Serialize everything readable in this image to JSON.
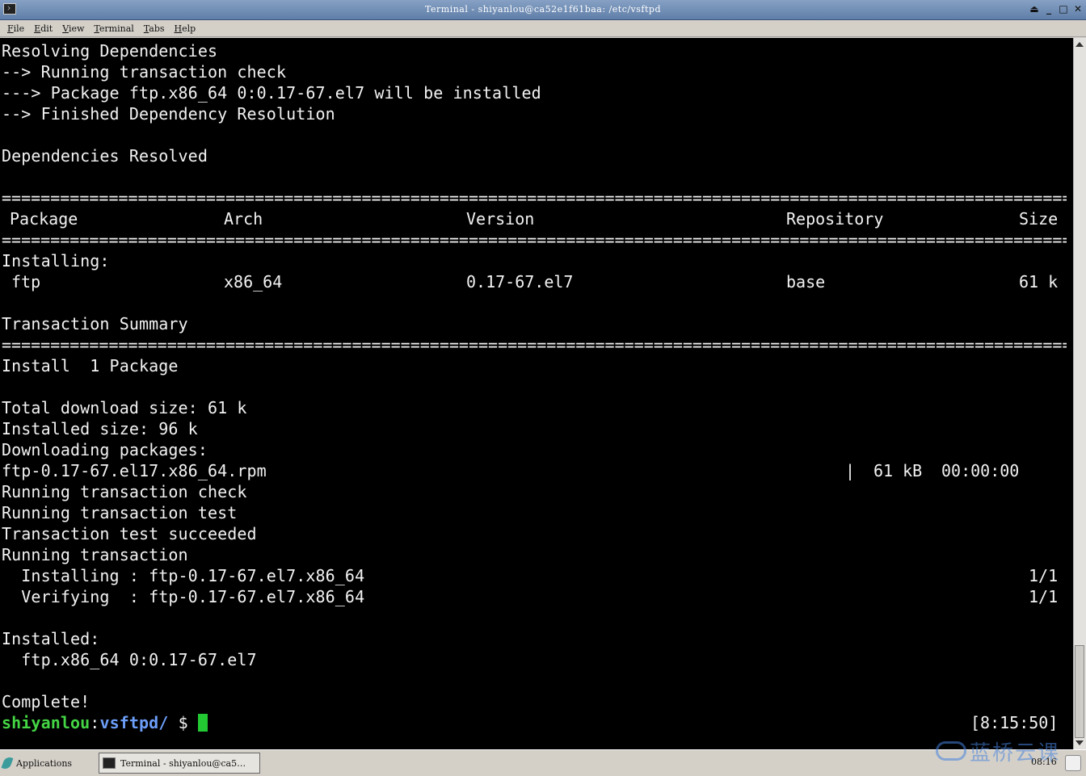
{
  "window": {
    "title": "Terminal - shiyanlou@ca52e1f61baa: /etc/vsftpd",
    "buttons": {
      "shade": "⏏",
      "minimize": "_",
      "maximize": "□",
      "close": "✕"
    }
  },
  "menu": [
    "File",
    "Edit",
    "View",
    "Terminal",
    "Tabs",
    "Help"
  ],
  "terminal": {
    "lines_top": [
      "Resolving Dependencies",
      "--> Running transaction check",
      "---> Package ftp.x86_64 0:0.17-67.el7 will be installed",
      "--> Finished Dependency Resolution",
      "",
      "Dependencies Resolved"
    ],
    "separator": "==============================================================================================================",
    "table_header": {
      "package": "Package",
      "arch": "Arch",
      "version": "Version",
      "repository": "Repository",
      "size": "Size"
    },
    "installing_label": "Installing:",
    "table_row": {
      "package": "ftp",
      "arch": "x86_64",
      "version": "0.17-67.el7",
      "repository": "base",
      "size": "61 k"
    },
    "summary_label": "Transaction Summary",
    "install_count": "Install  1 Package",
    "download_size": "Total download size: 61 k",
    "installed_size": "Installed size: 96 k",
    "downloading": "Downloading packages:",
    "rpm": {
      "file": "ftp-0.17-67.el17.x86_64.rpm",
      "bar": "|",
      "size": "61 kB",
      "time": "00:00:00"
    },
    "running_check": "Running transaction check",
    "running_test": "Running transaction test",
    "test_succeeded": "Transaction test succeeded",
    "running_tx": "Running transaction",
    "installing_step": {
      "text": "  Installing : ftp-0.17-67.el7.x86_64",
      "count": "1/1"
    },
    "verifying_step": {
      "text": "  Verifying  : ftp-0.17-67.el7.x86_64",
      "count": "1/1"
    },
    "installed_label": "Installed:",
    "installed_pkg": "  ftp.x86_64 0:0.17-67.el7",
    "complete": "Complete!",
    "prompt": {
      "user": "shiyanlou",
      "colon": ":",
      "path": "vsftpd/",
      "symbol": " $ ",
      "time": "[8:15:50]"
    }
  },
  "taskbar": {
    "applications": "Applications",
    "task_label": "Terminal - shiyanlou@ca5…",
    "watermark": "蓝桥云课",
    "clock": "08:16"
  },
  "colors": {
    "terminal_bg": "#000000",
    "terminal_fg": "#f2f2f2",
    "prompt_user": "#44d544",
    "prompt_path": "#6c9ef8",
    "cursor": "#22c933"
  }
}
